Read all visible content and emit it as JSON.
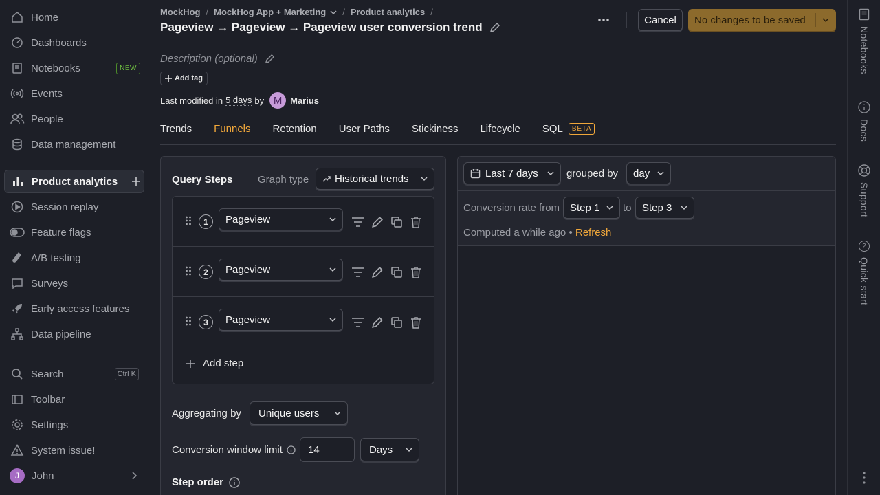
{
  "sidebar": {
    "items": [
      {
        "label": "Home",
        "icon": "home-icon"
      },
      {
        "label": "Dashboards",
        "icon": "dashboard-icon"
      },
      {
        "label": "Notebooks",
        "icon": "notebook-icon",
        "badge": "NEW"
      },
      {
        "label": "Events",
        "icon": "broadcast-icon"
      },
      {
        "label": "People",
        "icon": "people-icon"
      },
      {
        "label": "Data management",
        "icon": "database-icon"
      },
      {
        "label": "Product analytics",
        "icon": "bar-chart-icon",
        "active": true
      },
      {
        "label": "Session replay",
        "icon": "play-circle-icon"
      },
      {
        "label": "Feature flags",
        "icon": "toggle-icon"
      },
      {
        "label": "A/B testing",
        "icon": "flask-icon"
      },
      {
        "label": "Surveys",
        "icon": "chat-bubble-icon"
      },
      {
        "label": "Early access features",
        "icon": "rocket-icon"
      },
      {
        "label": "Data pipeline",
        "icon": "pipeline-icon"
      }
    ],
    "bottom": {
      "search": "Search",
      "search_shortcut": "Ctrl K",
      "toolbar": "Toolbar",
      "settings": "Settings",
      "system_issue": "System issue!",
      "user_initial": "J",
      "user_name": "John"
    }
  },
  "rail": {
    "notebooks": "Notebooks",
    "docs": "Docs",
    "support": "Support",
    "quick_start": "Quick start",
    "quick_start_count": "2"
  },
  "header": {
    "breadcrumbs": [
      "MockHog",
      "MockHog App + Marketing",
      "Product analytics"
    ],
    "title": "Pageview → Pageview → Pageview user conversion trend",
    "cancel": "Cancel",
    "save": "No changes to be saved"
  },
  "meta": {
    "description_placeholder": "Description (optional)",
    "add_tag": "Add tag",
    "modified_prefix": "Last modified in",
    "modified_when": "5 days",
    "modified_by": "by",
    "author_initial": "M",
    "author": "Marius"
  },
  "tabs": [
    {
      "label": "Trends"
    },
    {
      "label": "Funnels",
      "active": true
    },
    {
      "label": "Retention"
    },
    {
      "label": "User Paths"
    },
    {
      "label": "Stickiness"
    },
    {
      "label": "Lifecycle"
    },
    {
      "label": "SQL",
      "badge": "BETA"
    }
  ],
  "query": {
    "title": "Query Steps",
    "graph_type_label": "Graph type",
    "graph_type_value": "Historical trends",
    "steps": [
      {
        "number": "1",
        "event": "Pageview"
      },
      {
        "number": "2",
        "event": "Pageview"
      },
      {
        "number": "3",
        "event": "Pageview"
      }
    ],
    "add_step": "Add step",
    "aggregating_label": "Aggregating by",
    "aggregating_value": "Unique users",
    "window_label": "Conversion window limit",
    "window_value": "14",
    "window_unit": "Days",
    "step_order_label": "Step order"
  },
  "results": {
    "date_range": "Last 7 days",
    "grouped_by_label": "grouped by",
    "interval": "day",
    "conversion_from_label": "Conversion rate from",
    "from_step": "Step 1",
    "to_label": "to",
    "to_step": "Step 3",
    "computed": "Computed a while ago",
    "bullet": "•",
    "refresh": "Refresh"
  },
  "colors": {
    "accent": "#f0a73a",
    "save_button": "#8c6a2c",
    "background": "#1d1f27"
  }
}
